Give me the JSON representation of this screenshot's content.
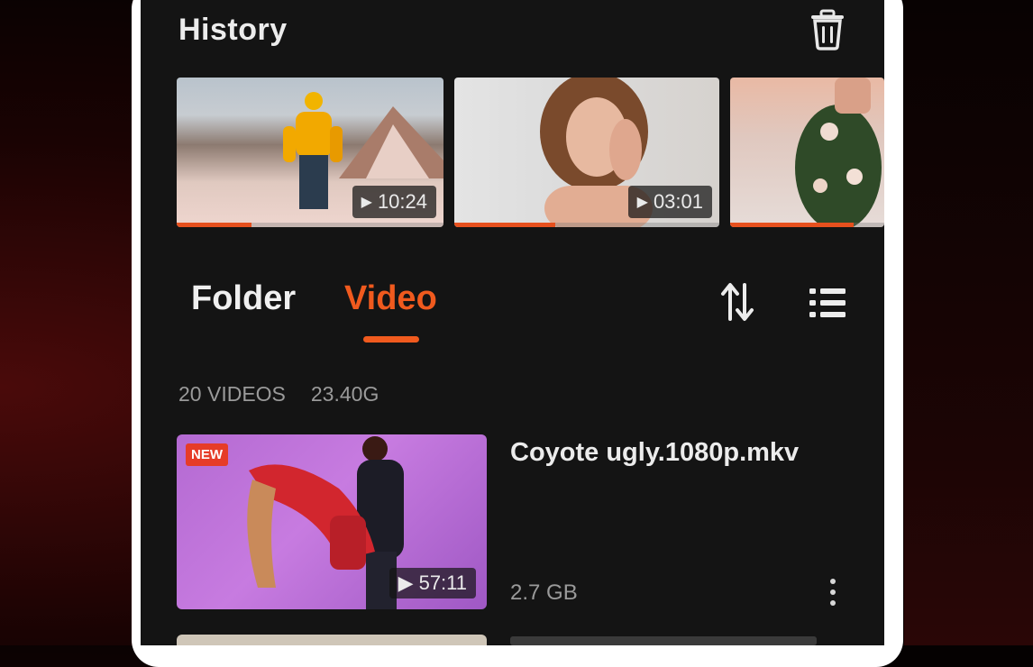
{
  "history": {
    "title": "History",
    "clear_icon": "trash-icon",
    "items": [
      {
        "duration": "10:24",
        "progress": 0.28
      },
      {
        "duration": "03:01",
        "progress": 0.38
      },
      {
        "duration": "",
        "progress": 0.8
      }
    ]
  },
  "tabs": {
    "folder_label": "Folder",
    "video_label": "Video",
    "active": "Video",
    "sort_icon": "sort-arrows-icon",
    "view_icon": "list-view-icon"
  },
  "stats": {
    "count": "20 VIDEOS",
    "total_size": "23.40G"
  },
  "videos": [
    {
      "badge": "NEW",
      "duration": "57:11",
      "title": "Coyote ugly.1080p.mkv",
      "size": "2.7 GB",
      "menu_icon": "more-vertical-icon"
    }
  ],
  "colors": {
    "accent": "#f05a1e",
    "background": "#141414",
    "text": "#ececec",
    "muted": "#9a9a9a"
  }
}
